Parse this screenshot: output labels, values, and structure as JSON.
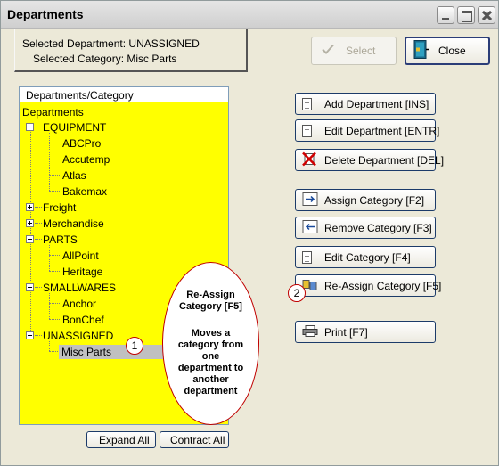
{
  "window": {
    "title": "Departments"
  },
  "selection": {
    "department_label": "Selected Department: UNASSIGNED",
    "category_label": "Selected Category: Misc Parts"
  },
  "top_buttons": {
    "select": "Select",
    "close": "Close"
  },
  "tree": {
    "header": "Departments/Category",
    "root": "Departments",
    "nodes": [
      {
        "label": "EQUIPMENT",
        "expanded": true,
        "children": [
          "ABCPro",
          "Accutemp",
          "Atlas",
          "Bakemax"
        ]
      },
      {
        "label": "Freight",
        "expanded": false,
        "children": []
      },
      {
        "label": "Merchandise",
        "expanded": false,
        "children": []
      },
      {
        "label": "PARTS",
        "expanded": true,
        "children": [
          "AllPoint",
          "Heritage"
        ]
      },
      {
        "label": "SMALLWARES",
        "expanded": true,
        "children": [
          "Anchor",
          "BonChef"
        ]
      },
      {
        "label": "UNASSIGNED",
        "expanded": true,
        "children": [
          "Misc Parts"
        ]
      }
    ],
    "selected": "Misc Parts",
    "background_color": "#ffff00"
  },
  "annotation": {
    "title_line1": "Re-Assign",
    "title_line2": "Category [F5]",
    "body_lines": [
      "Moves a",
      "category from",
      "one",
      "department to",
      "another",
      "department"
    ],
    "callout_1": "1",
    "callout_2": "2"
  },
  "actions": {
    "add_department": "Add Department [INS]",
    "edit_department": "Edit Department [ENTR]",
    "delete_department": "Delete Department [DEL]",
    "assign_category": "Assign Category [F2]",
    "remove_category": "Remove Category [F3]",
    "edit_category": "Edit Category [F4]",
    "reassign_category": "Re-Assign Category [F5]",
    "print": "Print [F7]"
  },
  "bottom_buttons": {
    "expand_all": "Expand All",
    "contract_all": "Contract All"
  }
}
